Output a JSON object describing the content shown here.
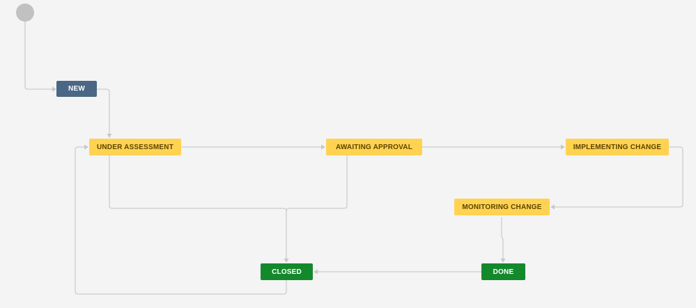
{
  "workflow": {
    "statuses": {
      "new": {
        "label": "NEW",
        "category": "todo",
        "color": "#4a6785"
      },
      "under_assessment": {
        "label": "UNDER ASSESSMENT",
        "category": "inprogress",
        "color": "#ffd351"
      },
      "awaiting_approval": {
        "label": "AWAITING APPROVAL",
        "category": "inprogress",
        "color": "#ffd351"
      },
      "implementing_change": {
        "label": "IMPLEMENTING CHANGE",
        "category": "inprogress",
        "color": "#ffd351"
      },
      "monitoring_change": {
        "label": "MONITORING CHANGE",
        "category": "inprogress",
        "color": "#ffd351"
      },
      "closed": {
        "label": "CLOSED",
        "category": "done",
        "color": "#14892c"
      },
      "done": {
        "label": "DONE",
        "category": "done",
        "color": "#14892c"
      }
    },
    "transitions": [
      {
        "from": "start",
        "to": "new"
      },
      {
        "from": "new",
        "to": "under_assessment"
      },
      {
        "from": "under_assessment",
        "to": "awaiting_approval"
      },
      {
        "from": "awaiting_approval",
        "to": "implementing_change"
      },
      {
        "from": "implementing_change",
        "to": "monitoring_change"
      },
      {
        "from": "monitoring_change",
        "to": "done"
      },
      {
        "from": "done",
        "to": "closed"
      },
      {
        "from": "under_assessment",
        "to": "closed"
      },
      {
        "from": "awaiting_approval",
        "to": "closed"
      },
      {
        "from": "closed",
        "to": "under_assessment"
      }
    ]
  }
}
